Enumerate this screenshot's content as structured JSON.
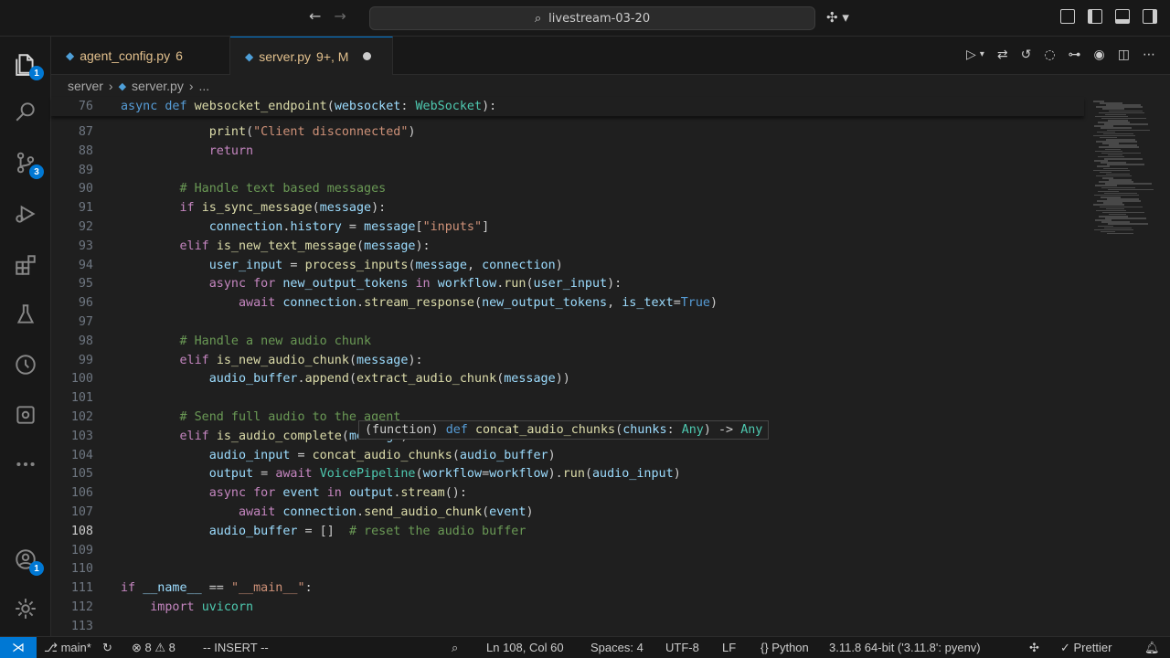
{
  "titlebar": {
    "search_text": "livestream-03-20"
  },
  "activity": {
    "explorer_badge": "1",
    "scm_badge": "3",
    "account_badge": "1"
  },
  "tabs": [
    {
      "name": "agent_config.py",
      "status": "6"
    },
    {
      "name": "server.py",
      "status": "9+, M"
    }
  ],
  "breadcrumb": {
    "folder": "server",
    "file": "server.py",
    "more": "..."
  },
  "editor": {
    "lines": [
      {
        "n": "76",
        "html": "<span class=\"kw\">async</span> <span class=\"kw\">def</span> <span class=\"fn\">websocket_endpoint</span>(<span class=\"var\">websocket</span>: <span class=\"cls\">WebSocket</span>):"
      },
      {
        "n": "87",
        "html": "            <span class=\"fn\">print</span>(<span class=\"str\">\"Client disconnected\"</span>)"
      },
      {
        "n": "88",
        "html": "            <span class=\"ctl\">return</span>"
      },
      {
        "n": "89",
        "html": ""
      },
      {
        "n": "90",
        "html": "        <span class=\"cm\"># Handle text based messages</span>"
      },
      {
        "n": "91",
        "html": "        <span class=\"ctl\">if</span> <span class=\"fn\">is_sync_message</span>(<span class=\"var\">message</span>):"
      },
      {
        "n": "92",
        "html": "            <span class=\"var\">connection</span>.<span class=\"var\">history</span> = <span class=\"var\">message</span>[<span class=\"str\">\"inputs\"</span>]"
      },
      {
        "n": "93",
        "html": "        <span class=\"ctl\">elif</span> <span class=\"fn\">is_new_text_message</span>(<span class=\"var\">message</span>):"
      },
      {
        "n": "94",
        "html": "            <span class=\"var\">user_input</span> = <span class=\"fn\">process_inputs</span>(<span class=\"var\">message</span>, <span class=\"var\">connection</span>)"
      },
      {
        "n": "95",
        "html": "            <span class=\"ctl\">async</span> <span class=\"ctl\">for</span> <span class=\"var\">new_output_tokens</span> <span class=\"ctl\">in</span> <span class=\"var\">workflow</span>.<span class=\"fn\">run</span>(<span class=\"var\">user_input</span>):"
      },
      {
        "n": "96",
        "html": "                <span class=\"ctl\">await</span> <span class=\"var\">connection</span>.<span class=\"fn\">stream_response</span>(<span class=\"var\">new_output_tokens</span>, <span class=\"var\">is_text</span>=<span class=\"bi\">True</span>)"
      },
      {
        "n": "97",
        "html": ""
      },
      {
        "n": "98",
        "html": "        <span class=\"cm\"># Handle a new audio chunk</span>"
      },
      {
        "n": "99",
        "html": "        <span class=\"ctl\">elif</span> <span class=\"fn\">is_new_audio_chunk</span>(<span class=\"var\">message</span>):"
      },
      {
        "n": "100",
        "html": "            <span class=\"var\">audio_buffer</span>.<span class=\"fn\">append</span>(<span class=\"fn\">extract_audio_chunk</span>(<span class=\"var\">message</span>))"
      },
      {
        "n": "101",
        "html": ""
      },
      {
        "n": "102",
        "html": "        <span class=\"cm\"># Send full audio to the agent</span>"
      },
      {
        "n": "103",
        "html": "        <span class=\"ctl\">elif</span> <span class=\"fn\">is_audio_complete</span>(<span class=\"var\">message</span>):"
      },
      {
        "n": "104",
        "html": "            <span class=\"var\">audio_input</span> = <span class=\"fn\">concat_audio_chunks</span>(<span class=\"var\">audio_buffer</span>)"
      },
      {
        "n": "105",
        "html": "            <span class=\"var\">output</span> = <span class=\"ctl\">await</span> <span class=\"cls\">VoicePipeline</span>(<span class=\"var\">workflow</span>=<span class=\"var\">workflow</span>).<span class=\"fn\">run</span>(<span class=\"var\">audio_input</span>)"
      },
      {
        "n": "106",
        "html": "            <span class=\"ctl\">async</span> <span class=\"ctl\">for</span> <span class=\"var\">event</span> <span class=\"ctl\">in</span> <span class=\"var\">output</span>.<span class=\"fn\">stream</span>():"
      },
      {
        "n": "107",
        "html": "                <span class=\"ctl\">await</span> <span class=\"var\">connection</span>.<span class=\"fn\">send_audio_chunk</span>(<span class=\"var\">event</span>)"
      },
      {
        "n": "108",
        "html": "            <span class=\"var\">audio_buffer</span> = []  <span class=\"cm\"># reset the audio buffer</span>"
      },
      {
        "n": "109",
        "html": ""
      },
      {
        "n": "110",
        "html": ""
      },
      {
        "n": "111",
        "html": "<span class=\"ctl\">if</span> <span class=\"var\">__name__</span> == <span class=\"str\">\"__main__\"</span>:"
      },
      {
        "n": "112",
        "html": "    <span class=\"ctl\">import</span> <span class=\"cls\">uvicorn</span>"
      },
      {
        "n": "113",
        "html": ""
      }
    ],
    "hover_html": "<span style=\"color:#ccc\">(function)</span> <span class=\"kw\">def</span> <span class=\"fn\">concat_audio_chunks</span>(<span class=\"var\">chunks</span>: <span class=\"cls\">Any</span>) -&gt; <span class=\"cls\">Any</span>"
  },
  "status": {
    "branch": "main*",
    "errors": "8",
    "warnings": "8",
    "mode": "-- INSERT --",
    "position": "Ln 108, Col 60",
    "spaces": "Spaces: 4",
    "encoding": "UTF-8",
    "eol": "LF",
    "language": "Python",
    "interpreter": "3.11.8 64-bit ('3.11.8': pyenv)",
    "formatter": "Prettier"
  },
  "colors": {
    "accent": "#0078d4",
    "background": "#1f1f1f",
    "modified": "#e2c08d"
  }
}
